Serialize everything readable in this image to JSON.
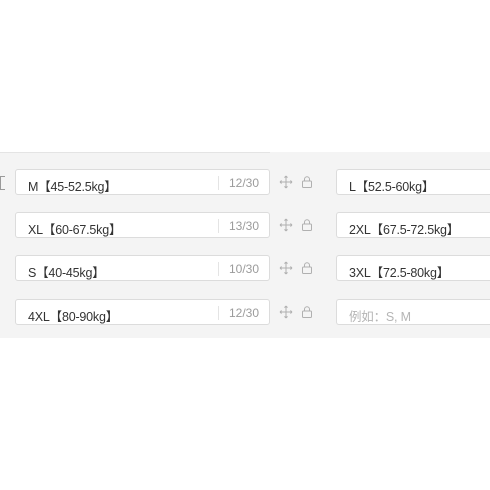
{
  "left_column": [
    {
      "value": "M【45-52.5kg】",
      "count": "12/30"
    },
    {
      "value": "XL【60-67.5kg】",
      "count": "13/30"
    },
    {
      "value": "S【40-45kg】",
      "count": "10/30"
    },
    {
      "value": "4XL【80-90kg】",
      "count": "12/30"
    }
  ],
  "right_column": [
    {
      "value": "L【52.5-60kg】"
    },
    {
      "value": "2XL【67.5-72.5kg】"
    },
    {
      "value": "3XL【72.5-80kg】"
    },
    {
      "value": "",
      "placeholder": "例如：S, M"
    }
  ],
  "icons": {
    "move": "move-icon",
    "lock": "lock-icon"
  },
  "colors": {
    "panel_bg": "#f4f4f4",
    "border": "#dcdcdc",
    "text": "#333333",
    "muted": "#9b9b9b",
    "placeholder": "#b5b5b5"
  }
}
